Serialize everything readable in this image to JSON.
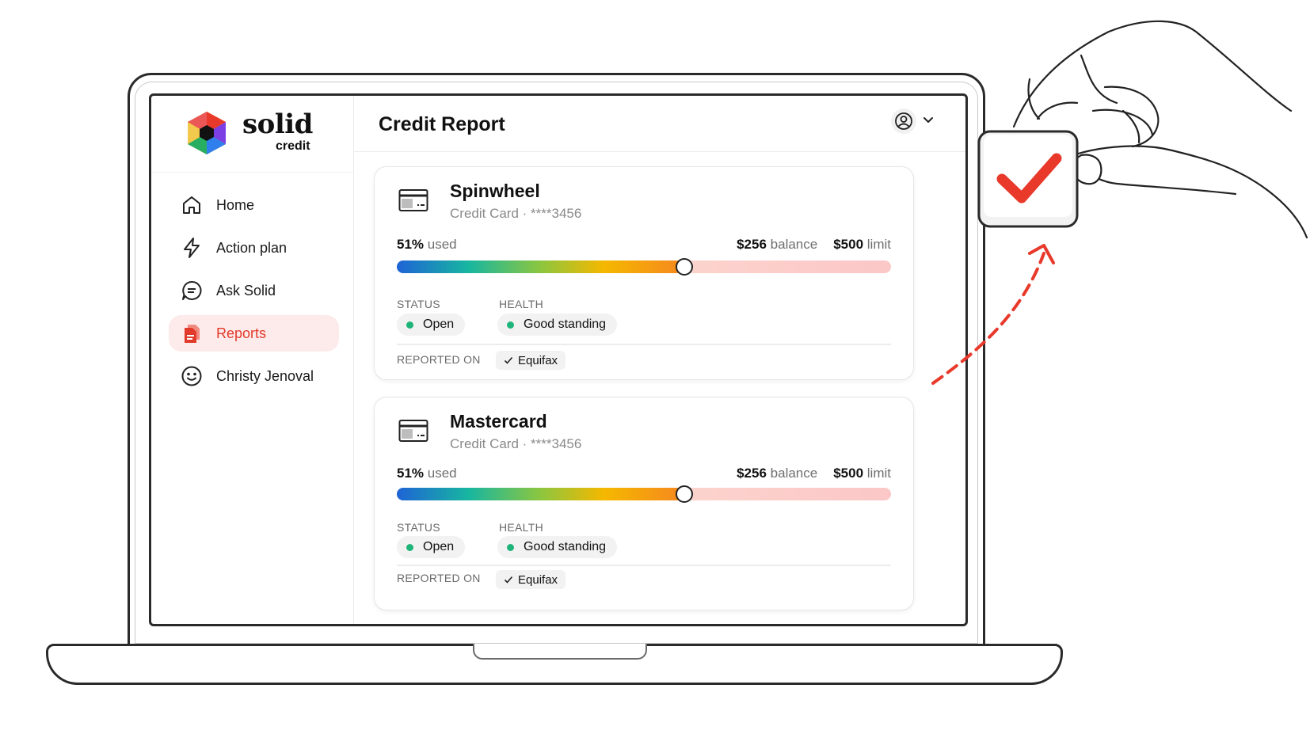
{
  "brand": {
    "name": "solid",
    "sub": "credit"
  },
  "sidebar": {
    "items": [
      {
        "label": "Home",
        "icon": "home-icon",
        "active": false
      },
      {
        "label": "Action plan",
        "icon": "bolt-icon",
        "active": false
      },
      {
        "label": "Ask Solid",
        "icon": "chat-icon",
        "active": false
      },
      {
        "label": "Reports",
        "icon": "document-icon",
        "active": true
      },
      {
        "label": "Christy Jenoval",
        "icon": "smiley-icon",
        "active": false
      }
    ]
  },
  "header": {
    "title": "Credit Report",
    "user_icon": "user-icon",
    "menu_icon": "chevron-down-icon"
  },
  "cards": [
    {
      "name": "Spinwheel",
      "subtitle": "Credit Card · ****3456",
      "used_pct": "51%",
      "used_label": "used",
      "utilization": 0.51,
      "balance": "$256",
      "balance_label": "balance",
      "limit": "$500",
      "limit_label": "limit",
      "status_label": "STATUS",
      "status": "Open",
      "health_label": "HEALTH",
      "health": "Good standing",
      "reported_label": "REPORTED ON",
      "bureau": "Equifax"
    },
    {
      "name": "Mastercard",
      "subtitle": "Credit Card · ****3456",
      "used_pct": "51%",
      "used_label": "used",
      "utilization": 0.51,
      "balance": "$256",
      "balance_label": "balance",
      "limit": "$500",
      "limit_label": "limit",
      "status_label": "STATUS",
      "status": "Open",
      "health_label": "HEALTH",
      "health": "Good standing",
      "reported_label": "REPORTED ON",
      "bureau": "Equifax"
    }
  ],
  "colors": {
    "accent": "#e23a2a",
    "active_bg": "#fdeaea",
    "status_dot": "#1fb57a",
    "checkmark": "#e8392b"
  },
  "illustration": {
    "hand_icon": "hand-illustration",
    "check_icon": "checkmark-icon",
    "arrow_icon": "dashed-arrow-icon"
  }
}
